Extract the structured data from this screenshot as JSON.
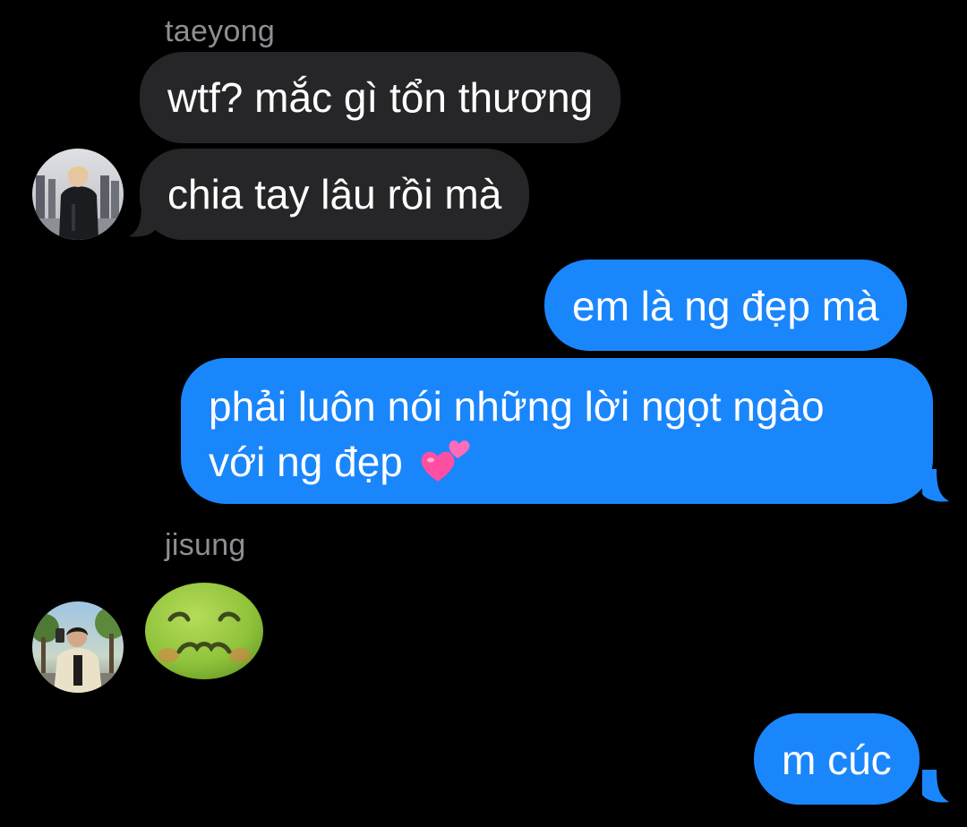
{
  "conversation": {
    "messages": [
      {
        "sender": "taeyong",
        "text": "wtf? mắc gì tổn thương",
        "direction": "incoming"
      },
      {
        "text": "chia tay lâu rồi mà",
        "direction": "incoming"
      },
      {
        "text": "em là ng đẹp mà",
        "direction": "outgoing"
      },
      {
        "text_line1": "phải luôn nói những lời ngọt ngào",
        "text_line2": "với ng đẹp",
        "emoji": "two-hearts-emoji",
        "direction": "outgoing"
      },
      {
        "sender": "jisung",
        "emoji": "nauseated-face-emoji",
        "direction": "incoming"
      },
      {
        "text": "m cúc",
        "direction": "outgoing"
      }
    ]
  },
  "colors": {
    "background": "#000000",
    "incoming_bubble": "#262628",
    "outgoing_bubble": "#1a86fc",
    "sender_name": "#8e8e93",
    "text": "#ffffff"
  },
  "icons": {
    "avatar_taeyong": "profile-photo",
    "avatar_jisung": "profile-photo"
  }
}
